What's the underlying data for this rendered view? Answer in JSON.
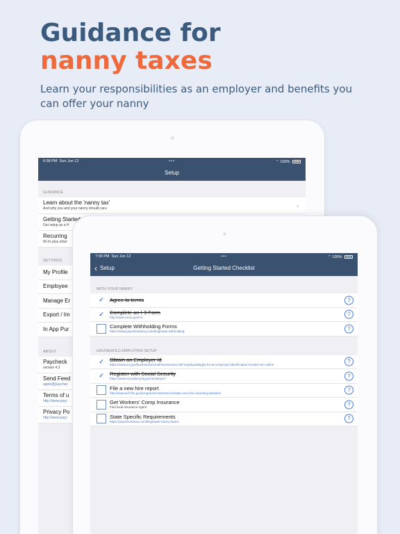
{
  "headline": {
    "line1": "Guidance for",
    "line2": "nanny taxes"
  },
  "subhead": "Learn your responsibilities as an employer and benefits you can offer your nanny",
  "back_screen": {
    "status": {
      "time": "6:58 PM",
      "date": "Sun Jun 12",
      "dots": "•••",
      "battery": "100%"
    },
    "title": "Setup",
    "guidance_header": "GUIDANCE",
    "guidance": [
      {
        "title": "Learn about the 'nanny tax'",
        "sub": "And why you and your nanny should care"
      },
      {
        "title": "Getting Started",
        "sub": "Get setup as a H"
      },
      {
        "title": "Recurring",
        "sub": "W-2s plus other"
      }
    ],
    "settings_header": "SETTINGS",
    "settings": [
      "My Profile",
      "Employee",
      "Manage Er",
      "Export / Im",
      "In App Pur"
    ],
    "about_header": "ABOUT",
    "about": [
      {
        "title": "Paycheck",
        "sub": "version 4.3"
      },
      {
        "title": "Send Feed",
        "link": "apple@paychec"
      },
      {
        "title": "Terms of u",
        "link": "http://www.payc"
      },
      {
        "title": "Privacy Po",
        "link": "http://www.payc"
      }
    ]
  },
  "front_screen": {
    "status": {
      "time": "7:00 PM",
      "date": "Sun Jun 12",
      "dots": "•••",
      "battery": "100%"
    },
    "back_label": "Setup",
    "title": "Getting Started Checklist",
    "sections": [
      {
        "header": "WITH YOUR NANNY",
        "items": [
          {
            "title": "Agree to terms",
            "url": "",
            "done": true
          },
          {
            "title": "Complete an I-9 Form",
            "url": "http://www.uscis.gov/i-9",
            "done": true
          },
          {
            "title": "Complete Withholding Forms",
            "url": "https://www.paycheckanny.com/blog/state-withholding-",
            "done": false
          }
        ]
      },
      {
        "header": "HOUSEHOLD EMPLOYER SETUP",
        "items": [
          {
            "title": "Obtain an Employer Id",
            "url": "https://www.irs.gov/businesses/small-businesses-self-employed/apply-for-an-employer-identification-number-ein-online",
            "done": true
          },
          {
            "title": "Register with Social Security",
            "url": "https://www.socialsecurity.gov/employer/",
            "done": true
          },
          {
            "title": "File a new hire report",
            "url": "http://www.acf.hhs.gov/programs/css/resource/state-new-hire-reporting-websites",
            "done": false
          },
          {
            "title": "Get Workers' Comp Insurance",
            "url": "Find local Insurance Agent",
            "done": false,
            "plain": true
          },
          {
            "title": "State Specific Requirements",
            "url": "https://paycheckanny.com/blog/state-nanny-taxes/",
            "done": false
          }
        ]
      }
    ]
  }
}
